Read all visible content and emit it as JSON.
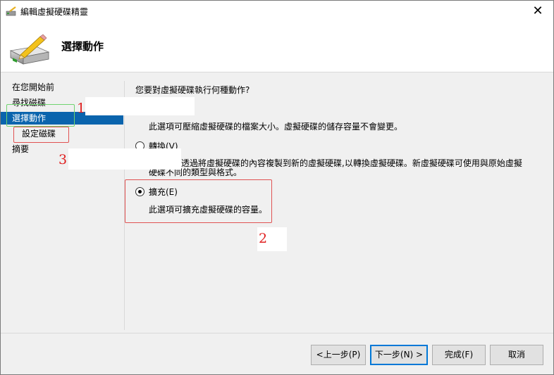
{
  "window": {
    "title": "編輯虛擬硬碟精靈",
    "close_glyph": "✕"
  },
  "header": {
    "title": "選擇動作"
  },
  "nav": {
    "items": [
      {
        "label": "在您開始前"
      },
      {
        "label": "尋找磁碟"
      },
      {
        "label": "選擇動作"
      },
      {
        "label": "設定磁碟"
      },
      {
        "label": "摘要"
      }
    ]
  },
  "main": {
    "question": "您要對虛擬硬碟執行何種動作?",
    "compact_description": "此選項可壓縮虛擬硬碟的檔案大小。虛擬硬碟的儲存容量不會變更。",
    "convert_label": "轉換(V)",
    "convert_description_line1": "可透過將虛擬硬碟的內容複製到新的虛擬硬碟,以轉換虛擬硬碟。新虛擬硬碟可使用與原始虛擬",
    "convert_description_line2": "硬碟不同的類型與格式。",
    "expand_label": "擴充(E)",
    "expand_description": "此選項可擴充虛擬硬碟的容量。"
  },
  "annotations": {
    "one": "1",
    "two": "2",
    "three": "3"
  },
  "buttons": {
    "previous": "<上一步(P)",
    "next": "下一步(N) >",
    "finish": "完成(F)",
    "cancel": "取消"
  },
  "colors": {
    "selection": "#0a64ad",
    "annotation_red": "#e05252",
    "annotation_green": "#6fd36f"
  }
}
